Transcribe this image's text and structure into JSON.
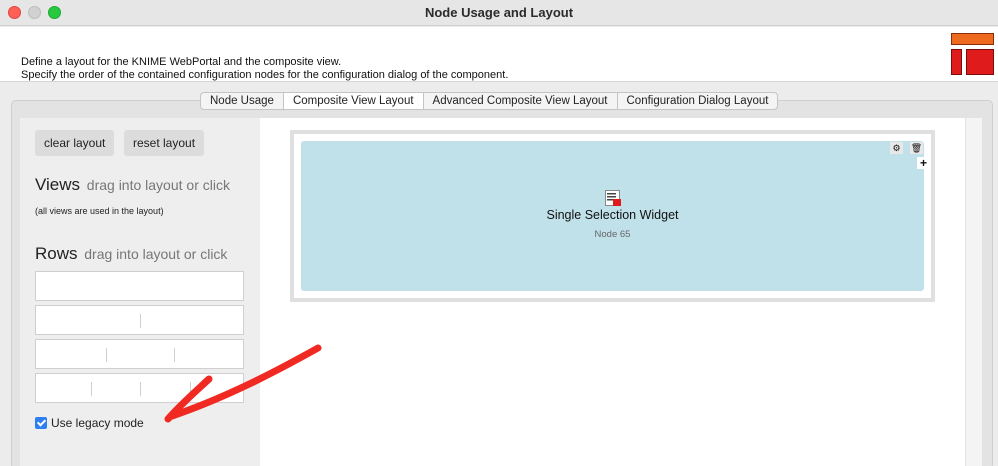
{
  "window": {
    "title": "Node Usage and Layout",
    "traffic_lights": [
      "close",
      "minimize",
      "maximize"
    ]
  },
  "header": {
    "description_line1": "Define a layout for the KNIME WebPortal and the composite view.",
    "description_line2": "Specify the order of the contained configuration nodes for the configuration dialog of the component.",
    "logo_icon": "knime-layout-logo-icon"
  },
  "tabs": [
    {
      "label": "Node Usage",
      "active": false
    },
    {
      "label": "Composite View Layout",
      "active": true
    },
    {
      "label": "Advanced Composite View Layout",
      "active": false
    },
    {
      "label": "Configuration Dialog Layout",
      "active": false
    }
  ],
  "left_panel": {
    "clear_layout_label": "clear layout",
    "reset_layout_label": "reset layout",
    "views_title": "Views",
    "views_hint": "drag into layout or click",
    "views_note": "(all views are used in the layout)",
    "rows_title": "Rows",
    "rows_hint": "drag into layout or click",
    "row_templates": [
      {
        "columns": 1
      },
      {
        "columns": 2
      },
      {
        "columns": 3
      },
      {
        "columns": 4
      }
    ],
    "legacy_mode_label": "Use legacy mode",
    "legacy_mode_checked": true
  },
  "layout": {
    "view_title": "Single Selection Widget",
    "view_node": "Node 65",
    "view_icon": "selection-widget-icon",
    "toolbar_icons": [
      "gear-icon",
      "trash-icon",
      "plus-icon"
    ]
  },
  "colors": {
    "view_background": "#c1e1ea",
    "checkbox_accent": "#2f7ff0",
    "annotation_arrow": "#f02a22"
  }
}
